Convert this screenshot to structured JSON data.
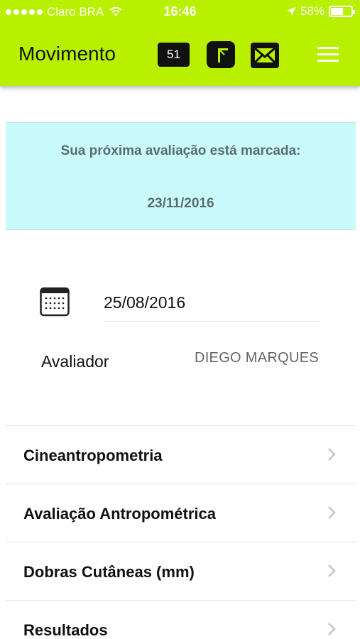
{
  "status_bar": {
    "carrier": "Claro BRA",
    "time": "16:46",
    "battery": "58%"
  },
  "header": {
    "title": "Movimento",
    "badge_count": "51",
    "icons": [
      "gate-icon",
      "mail-icon",
      "menu-icon"
    ]
  },
  "banner": {
    "text": "Sua próxima avaliação está marcada:",
    "date": "23/11/2016",
    "background": "#c9fbfd"
  },
  "evaluation": {
    "date": "25/08/2016",
    "evaluator_label": "Avaliador",
    "evaluator_name": "DIEGO MARQUES"
  },
  "menu": [
    {
      "label": "Cineantropometria"
    },
    {
      "label": "Avaliação Antropométrica"
    },
    {
      "label": "Dobras Cutâneas (mm)"
    },
    {
      "label": "Resultados"
    }
  ],
  "colors": {
    "accent": "#b8f000"
  }
}
